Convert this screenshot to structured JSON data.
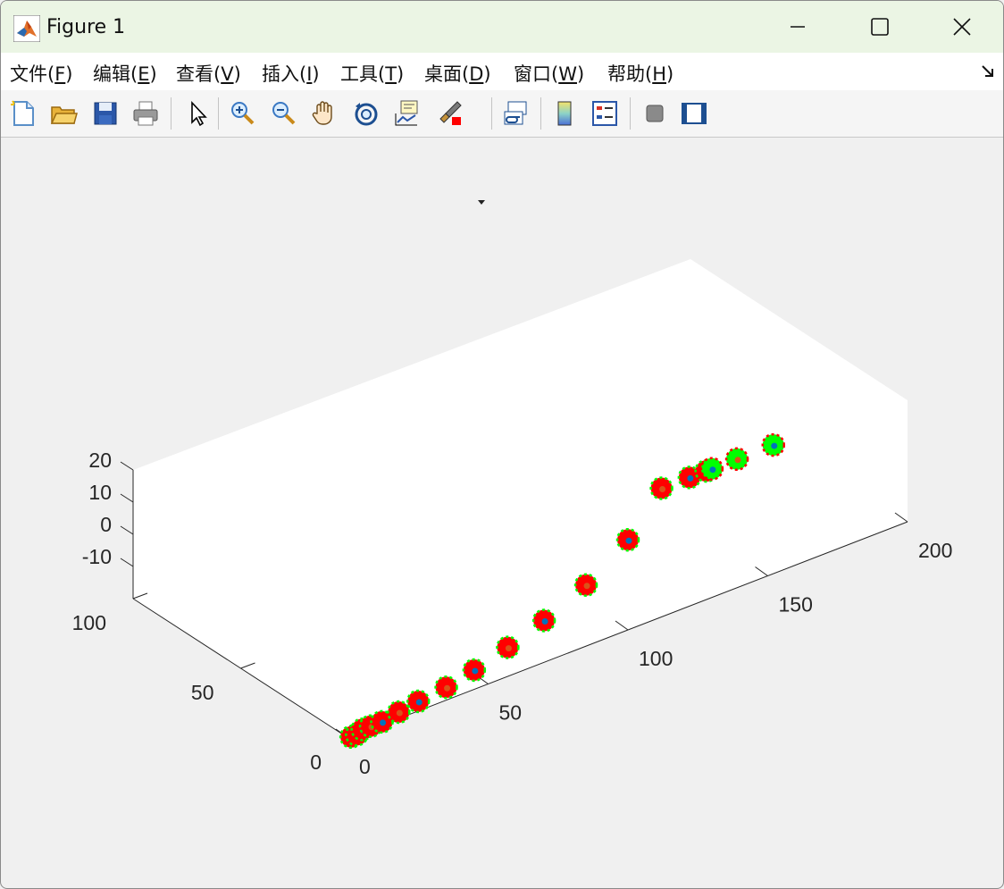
{
  "window": {
    "title": "Figure 1"
  },
  "menu": {
    "file": "文件(F)",
    "file_pre": "文件(",
    "file_key": "F",
    "file_post": ")",
    "edit_pre": "编辑(",
    "edit_key": "E",
    "edit_post": ")",
    "view_pre": "查看(",
    "view_key": "V",
    "view_post": ")",
    "insert_pre": "插入(",
    "insert_key": "I",
    "insert_post": ")",
    "tools_pre": "工具(",
    "tools_key": "T",
    "tools_post": ")",
    "desktop_pre": "桌面(",
    "desktop_key": "D",
    "desktop_post": ")",
    "window_pre": "窗口(",
    "window_key": "W",
    "window_post": ")",
    "help_pre": "帮助(",
    "help_key": "H",
    "help_post": ")"
  },
  "toolbar_icons": [
    "new-figure-icon",
    "open-file-icon",
    "save-icon",
    "print-icon",
    "select-arrow-icon",
    "zoom-in-icon",
    "zoom-out-icon",
    "pan-hand-icon",
    "rotate-3d-icon",
    "data-cursor-icon",
    "brush-icon",
    "link-plot-icon",
    "colorbar-icon",
    "legend-icon",
    "hide-plot-tools-icon",
    "show-plot-tools-icon"
  ],
  "colors": {
    "red": "#ff0000",
    "green": "#00ff00",
    "blue": "#0072bd",
    "orange": "#d95319",
    "titlebar": "#ebf5e4"
  },
  "chart_data": {
    "type": "scatter",
    "dimensions": 3,
    "x_ticks": [
      "0",
      "50",
      "100",
      "150",
      "200"
    ],
    "y_ticks": [
      "0",
      "50",
      "100"
    ],
    "z_ticks": [
      "-10",
      "0",
      "10",
      "20"
    ],
    "xlim": [
      0,
      200
    ],
    "ylim": [
      0,
      100
    ],
    "zlim": [
      -20,
      20
    ],
    "grid": false,
    "box": false,
    "series": [
      {
        "marker_color": "#ff0000",
        "marker_edge": "#00ff00",
        "x": [
          1,
          3,
          5,
          8,
          12,
          18,
          25,
          35,
          45,
          57,
          70,
          85,
          100,
          112,
          122,
          128
        ],
        "y": [
          0,
          0,
          0,
          0,
          0,
          0,
          0,
          0,
          0,
          0,
          0,
          0,
          0,
          0,
          0,
          0
        ],
        "z": [
          -20,
          -20,
          -19,
          -19,
          -19,
          -18,
          -17,
          -16,
          -14,
          -11,
          -7,
          -1,
          8,
          20,
          20,
          20
        ]
      },
      {
        "marker_color": "#00ff00",
        "marker_edge": "#ff0000",
        "x": [
          130,
          139,
          152
        ],
        "y": [
          0,
          0,
          0
        ],
        "z": [
          20,
          20,
          20
        ]
      }
    ]
  }
}
